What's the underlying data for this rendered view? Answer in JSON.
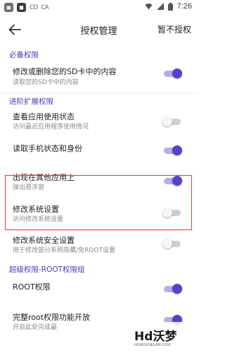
{
  "status_bar": {
    "time": "7:26",
    "left_icons": [
      "app-icon",
      "app-icon",
      "cloud-icon",
      "cloud-icon"
    ],
    "right_icons": [
      "wifi-icon",
      "signal-icon",
      "battery-icon"
    ]
  },
  "app_bar": {
    "title": "授权管理",
    "action": "暂不授权"
  },
  "accent_color": "#5a3fc7",
  "sections": [
    {
      "title": "必备权限"
    },
    {
      "title": "进阶扩展权限"
    },
    {
      "title": "超级权限-ROOT权限组"
    }
  ],
  "items": [
    {
      "title": "修改或删除您的SD卡中的内容",
      "subtitle": "读取您的SD卡中的内容",
      "enabled": true
    },
    {
      "title": "查看应用使用状态",
      "subtitle": "访问最近应用程序使用情况",
      "enabled": false
    },
    {
      "title": "读取手机状态和身份",
      "subtitle": "",
      "enabled": true
    },
    {
      "title": "出现在其他应用上",
      "subtitle": "弹出悬浮窗",
      "enabled": true
    },
    {
      "title": "修改系统设置",
      "subtitle": "访问修改系统设置",
      "enabled": false
    },
    {
      "title": "修改系统安全设置",
      "subtitle": "用于修改部分系统隐藏/免ROOT设置",
      "enabled": false
    },
    {
      "title": "ROOT权限",
      "subtitle": "",
      "enabled": true
    },
    {
      "title": "完整root权限功能开放",
      "subtitle": "开启此处完成最",
      "enabled": true
    }
  ],
  "watermark": {
    "text": "Hd沃梦",
    "subtext": "HDMOGOKLAM.COM"
  }
}
